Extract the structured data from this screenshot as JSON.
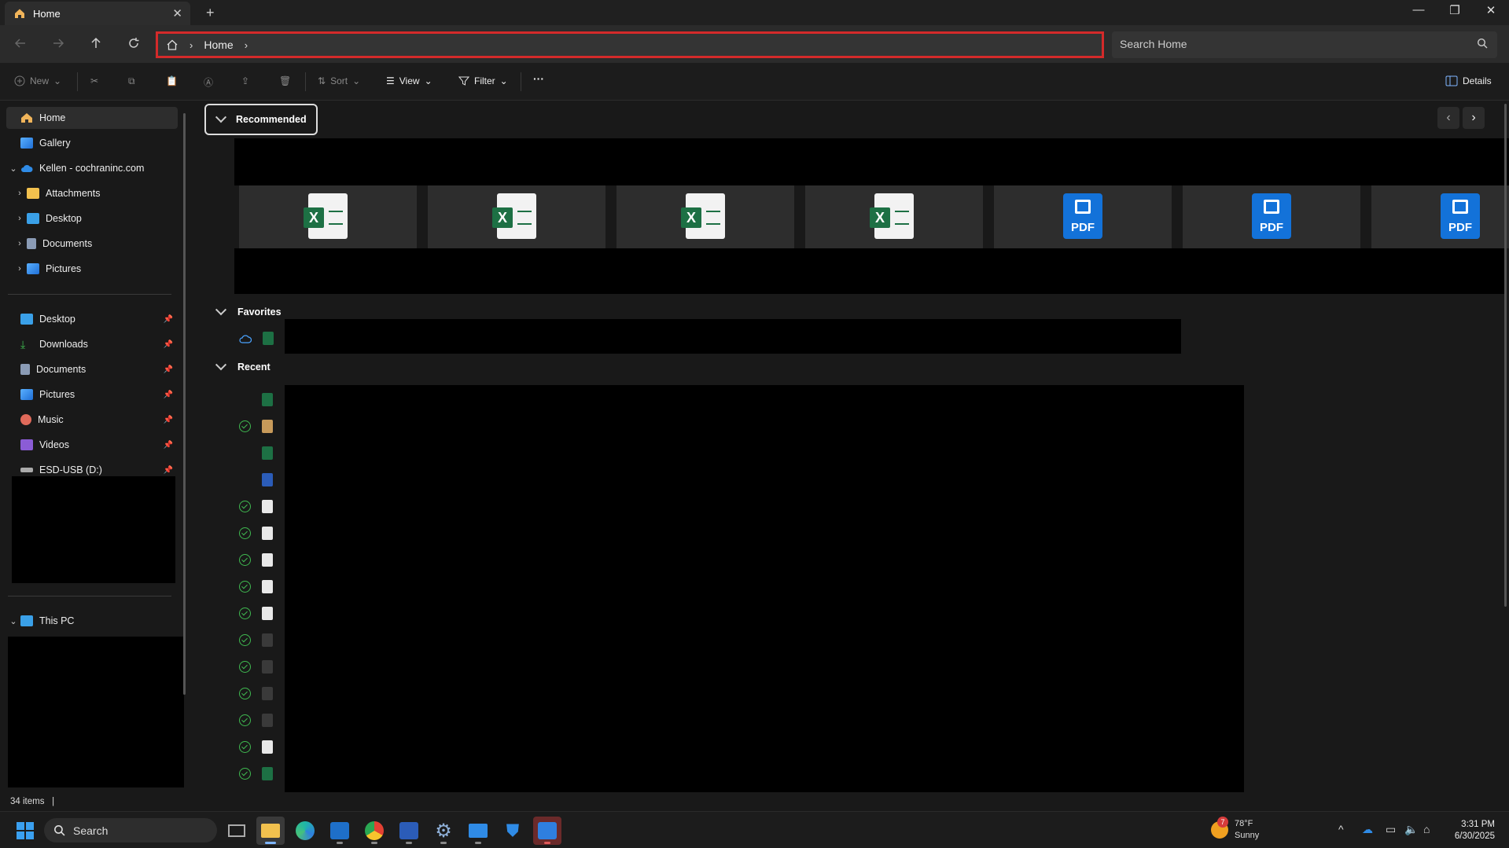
{
  "window": {
    "tab_title": "Home",
    "tab_close": "✕",
    "new_tab": "+",
    "minimize": "—",
    "restore": "❐",
    "close": "✕"
  },
  "address_bar": {
    "breadcrumb_home": "Home",
    "separator": "›",
    "search_placeholder": "Search Home"
  },
  "command_bar": {
    "new_label": "New",
    "sort_label": "Sort",
    "view_label": "View",
    "filter_label": "Filter",
    "more_label": "···",
    "details_label": "Details"
  },
  "sidebar": {
    "home": "Home",
    "gallery": "Gallery",
    "onedrive": "Kellen - cochraninc.com",
    "onedrive_children": [
      "Attachments",
      "Desktop",
      "Documents",
      "Pictures"
    ],
    "pinned": [
      "Desktop",
      "Downloads",
      "Documents",
      "Pictures",
      "Music",
      "Videos",
      "ESD-USB (D:)"
    ],
    "this_pc": "This PC"
  },
  "main": {
    "recommended_label": "Recommended",
    "favorites_label": "Favorites",
    "recent_label": "Recent",
    "recommended_cards": [
      "excel",
      "excel",
      "excel",
      "excel",
      "pdf",
      "pdf",
      "pdf"
    ],
    "pdf_badge": "PDF",
    "excel_badge": "X",
    "recent_rows": [
      {
        "synced": false,
        "type": "excel"
      },
      {
        "synced": true,
        "type": "archive"
      },
      {
        "synced": false,
        "type": "excel"
      },
      {
        "synced": false,
        "type": "word"
      },
      {
        "synced": true,
        "type": "doc"
      },
      {
        "synced": true,
        "type": "doc"
      },
      {
        "synced": true,
        "type": "doc"
      },
      {
        "synced": true,
        "type": "doc"
      },
      {
        "synced": true,
        "type": "doc"
      },
      {
        "synced": true,
        "type": "faint"
      },
      {
        "synced": true,
        "type": "faint"
      },
      {
        "synced": true,
        "type": "faint"
      },
      {
        "synced": true,
        "type": "faint"
      },
      {
        "synced": true,
        "type": "doc"
      },
      {
        "synced": true,
        "type": "excel"
      }
    ]
  },
  "status": {
    "item_count": "34 items",
    "divider": "|"
  },
  "taskbar": {
    "search_label": "Search",
    "weather_temp": "78°F",
    "weather_cond": "Sunny",
    "weather_badge": "7",
    "time": "3:31 PM",
    "date": "6/30/2025"
  },
  "colors": {
    "excel": "#1d7044",
    "pdf": "#1372d9",
    "word": "#2b5cb8",
    "highlight": "#d42a2a",
    "synced": "#3fb950"
  }
}
